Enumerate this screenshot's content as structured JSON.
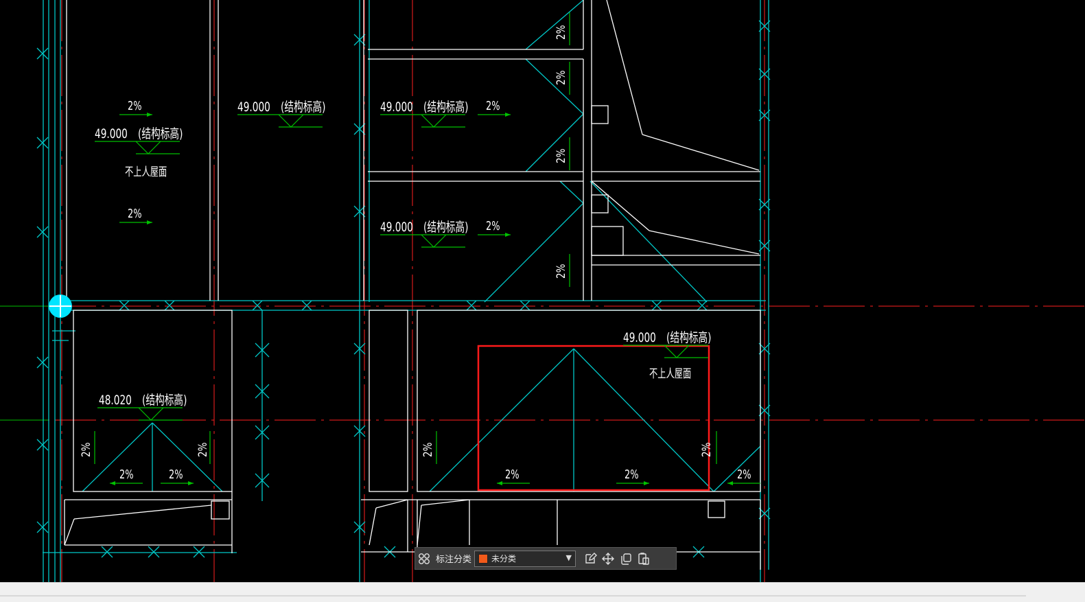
{
  "drawing": {
    "elevation_labels": [
      {
        "value": "49.000",
        "note": "(结构标高)"
      },
      {
        "value": "49.000",
        "note": "(结构标高)"
      },
      {
        "value": "49.000",
        "note": "(结构标高)"
      },
      {
        "value": "49.000",
        "note": "(结构标高)"
      },
      {
        "value": "49.000",
        "note": "(结构标高)"
      },
      {
        "value": "48.020",
        "note": "(结构标高)"
      }
    ],
    "roof_notes": [
      "不上人屋面",
      "不上人屋面"
    ],
    "slope_label": "2%",
    "colors": {
      "wall": "#ffffff",
      "axis": "#00c8c8",
      "gridline": "#ff2020",
      "annotation": "#00c000",
      "selection": "#ff1a1a"
    }
  },
  "toolbar": {
    "category_label": "标注分类",
    "category_value": "未分类",
    "swatch_color": "#f25a1a",
    "icons": [
      "grid-icon",
      "edit-icon",
      "move-icon",
      "copy-icon",
      "paste-icon"
    ]
  }
}
